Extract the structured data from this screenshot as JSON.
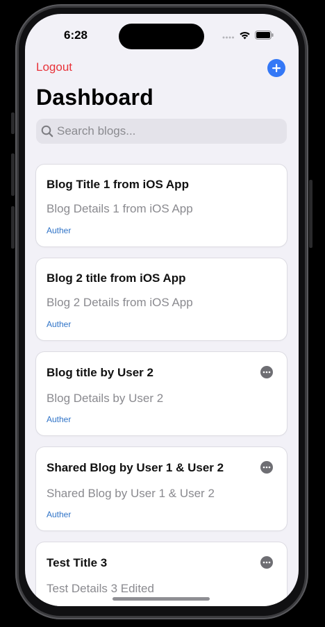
{
  "status_bar": {
    "time": "6:28"
  },
  "nav": {
    "logout_label": "Logout"
  },
  "page": {
    "title": "Dashboard"
  },
  "search": {
    "placeholder": "Search blogs...",
    "value": ""
  },
  "blogs": [
    {
      "title": "Blog Title 1 from iOS App",
      "details": "Blog Details 1 from iOS App",
      "author": "Auther",
      "has_menu": false
    },
    {
      "title": "Blog 2 title from iOS App",
      "details": "Blog 2 Details from iOS App",
      "author": "Auther",
      "has_menu": false
    },
    {
      "title": "Blog title by User 2",
      "details": "Blog Details by User 2",
      "author": "Auther",
      "has_menu": true
    },
    {
      "title": "Shared Blog by User 1 & User 2",
      "details": "Shared Blog by User 1 & User 2",
      "author": "Auther",
      "has_menu": true
    },
    {
      "title": "Test Title 3",
      "details": "Test Details 3 Edited",
      "author": "",
      "has_menu": true
    }
  ],
  "colors": {
    "accent": "#3478f6",
    "logout": "#e8333a",
    "author": "#2f73c7",
    "background": "#f2f1f7"
  },
  "icons": {
    "add": "plus-circle-icon",
    "search": "magnifying-glass-icon",
    "more": "ellipsis-circle-icon",
    "wifi": "wifi-icon",
    "battery": "battery-icon",
    "signal": "cellular-signal-icon"
  }
}
